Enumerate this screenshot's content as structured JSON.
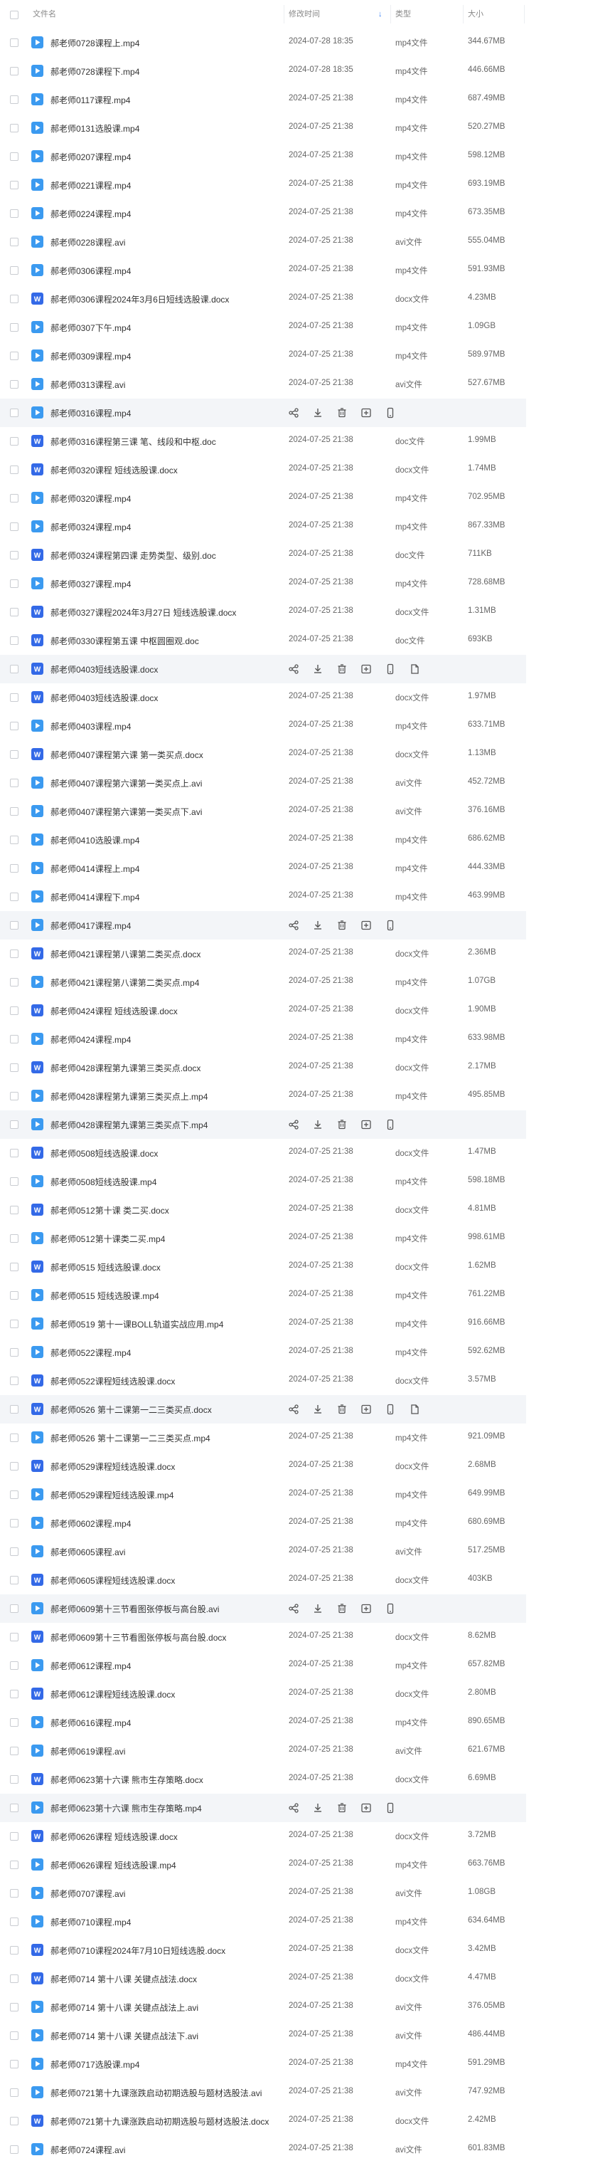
{
  "header": {
    "name": "文件名",
    "modified": "修改时间",
    "type": "类型",
    "size": "大小"
  },
  "rows": [
    {
      "name": "郝老师0728课程上.mp4",
      "date": "2024-07-28 18:35",
      "type": "mp4文件",
      "size": "344.67MB",
      "kind": "video"
    },
    {
      "name": "郝老师0728课程下.mp4",
      "date": "2024-07-28 18:35",
      "type": "mp4文件",
      "size": "446.66MB",
      "kind": "video"
    },
    {
      "name": "郝老师0117课程.mp4",
      "date": "2024-07-25 21:38",
      "type": "mp4文件",
      "size": "687.49MB",
      "kind": "video"
    },
    {
      "name": "郝老师0131选股课.mp4",
      "date": "2024-07-25 21:38",
      "type": "mp4文件",
      "size": "520.27MB",
      "kind": "video"
    },
    {
      "name": "郝老师0207课程.mp4",
      "date": "2024-07-25 21:38",
      "type": "mp4文件",
      "size": "598.12MB",
      "kind": "video"
    },
    {
      "name": "郝老师0221课程.mp4",
      "date": "2024-07-25 21:38",
      "type": "mp4文件",
      "size": "693.19MB",
      "kind": "video"
    },
    {
      "name": "郝老师0224课程.mp4",
      "date": "2024-07-25 21:38",
      "type": "mp4文件",
      "size": "673.35MB",
      "kind": "video"
    },
    {
      "name": "郝老师0228课程.avi",
      "date": "2024-07-25 21:38",
      "type": "avi文件",
      "size": "555.04MB",
      "kind": "video"
    },
    {
      "name": "郝老师0306课程.mp4",
      "date": "2024-07-25 21:38",
      "type": "mp4文件",
      "size": "591.93MB",
      "kind": "video"
    },
    {
      "name": "郝老师0306课程2024年3月6日短线选股课.docx",
      "date": "2024-07-25 21:38",
      "type": "docx文件",
      "size": "4.23MB",
      "kind": "doc"
    },
    {
      "name": "郝老师0307下午.mp4",
      "date": "2024-07-25 21:38",
      "type": "mp4文件",
      "size": "1.09GB",
      "kind": "video"
    },
    {
      "name": "郝老师0309课程.mp4",
      "date": "2024-07-25 21:38",
      "type": "mp4文件",
      "size": "589.97MB",
      "kind": "video"
    },
    {
      "name": "郝老师0313课程.avi",
      "date": "2024-07-25 21:38",
      "type": "avi文件",
      "size": "527.67MB",
      "kind": "video"
    },
    {
      "name": "郝老师0316课程.mp4",
      "hover": true,
      "kind": "video"
    },
    {
      "name": "郝老师0316课程第三课 笔、线段和中枢.doc",
      "date": "2024-07-25 21:38",
      "type": "doc文件",
      "size": "1.99MB",
      "kind": "doc"
    },
    {
      "name": "郝老师0320课程 短线选股课.docx",
      "date": "2024-07-25 21:38",
      "type": "docx文件",
      "size": "1.74MB",
      "kind": "doc"
    },
    {
      "name": "郝老师0320课程.mp4",
      "date": "2024-07-25 21:38",
      "type": "mp4文件",
      "size": "702.95MB",
      "kind": "video"
    },
    {
      "name": "郝老师0324课程.mp4",
      "date": "2024-07-25 21:38",
      "type": "mp4文件",
      "size": "867.33MB",
      "kind": "video"
    },
    {
      "name": "郝老师0324课程第四课 走势类型、级别.doc",
      "date": "2024-07-25 21:38",
      "type": "doc文件",
      "size": "711KB",
      "kind": "doc"
    },
    {
      "name": "郝老师0327课程.mp4",
      "date": "2024-07-25 21:38",
      "type": "mp4文件",
      "size": "728.68MB",
      "kind": "video"
    },
    {
      "name": "郝老师0327课程2024年3月27日 短线选股课.docx",
      "date": "2024-07-25 21:38",
      "type": "docx文件",
      "size": "1.31MB",
      "kind": "doc"
    },
    {
      "name": "郝老师0330课程第五课 中枢圆圈观.doc",
      "date": "2024-07-25 21:38",
      "type": "doc文件",
      "size": "693KB",
      "kind": "doc"
    },
    {
      "name": "郝老师0403短线选股课.docx",
      "hover": true,
      "kind": "doc",
      "extra": true
    },
    {
      "name": "郝老师0403短线选股课.docx",
      "date": "2024-07-25 21:38",
      "type": "docx文件",
      "size": "1.97MB",
      "kind": "doc"
    },
    {
      "name": "郝老师0403课程.mp4",
      "date": "2024-07-25 21:38",
      "type": "mp4文件",
      "size": "633.71MB",
      "kind": "video"
    },
    {
      "name": "郝老师0407课程第六课 第一类买点.docx",
      "date": "2024-07-25 21:38",
      "type": "docx文件",
      "size": "1.13MB",
      "kind": "doc"
    },
    {
      "name": "郝老师0407课程第六课第一类买点上.avi",
      "date": "2024-07-25 21:38",
      "type": "avi文件",
      "size": "452.72MB",
      "kind": "video"
    },
    {
      "name": "郝老师0407课程第六课第一类买点下.avi",
      "date": "2024-07-25 21:38",
      "type": "avi文件",
      "size": "376.16MB",
      "kind": "video"
    },
    {
      "name": "郝老师0410选股课.mp4",
      "date": "2024-07-25 21:38",
      "type": "mp4文件",
      "size": "686.62MB",
      "kind": "video"
    },
    {
      "name": "郝老师0414课程上.mp4",
      "date": "2024-07-25 21:38",
      "type": "mp4文件",
      "size": "444.33MB",
      "kind": "video"
    },
    {
      "name": "郝老师0414课程下.mp4",
      "date": "2024-07-25 21:38",
      "type": "mp4文件",
      "size": "463.99MB",
      "kind": "video"
    },
    {
      "name": "郝老师0417课程.mp4",
      "hover": true,
      "kind": "video"
    },
    {
      "name": "郝老师0421课程第八课第二类买点.docx",
      "date": "2024-07-25 21:38",
      "type": "docx文件",
      "size": "2.36MB",
      "kind": "doc"
    },
    {
      "name": "郝老师0421课程第八课第二类买点.mp4",
      "date": "2024-07-25 21:38",
      "type": "mp4文件",
      "size": "1.07GB",
      "kind": "video"
    },
    {
      "name": "郝老师0424课程 短线选股课.docx",
      "date": "2024-07-25 21:38",
      "type": "docx文件",
      "size": "1.90MB",
      "kind": "doc"
    },
    {
      "name": "郝老师0424课程.mp4",
      "date": "2024-07-25 21:38",
      "type": "mp4文件",
      "size": "633.98MB",
      "kind": "video"
    },
    {
      "name": "郝老师0428课程第九课第三类买点.docx",
      "date": "2024-07-25 21:38",
      "type": "docx文件",
      "size": "2.17MB",
      "kind": "doc"
    },
    {
      "name": "郝老师0428课程第九课第三类买点上.mp4",
      "date": "2024-07-25 21:38",
      "type": "mp4文件",
      "size": "495.85MB",
      "kind": "video"
    },
    {
      "name": "郝老师0428课程第九课第三类买点下.mp4",
      "hover": true,
      "kind": "video"
    },
    {
      "name": "郝老师0508短线选股课.docx",
      "date": "2024-07-25 21:38",
      "type": "docx文件",
      "size": "1.47MB",
      "kind": "doc"
    },
    {
      "name": "郝老师0508短线选股课.mp4",
      "date": "2024-07-25 21:38",
      "type": "mp4文件",
      "size": "598.18MB",
      "kind": "video"
    },
    {
      "name": "郝老师0512第十课 类二买.docx",
      "date": "2024-07-25 21:38",
      "type": "docx文件",
      "size": "4.81MB",
      "kind": "doc"
    },
    {
      "name": "郝老师0512第十课类二买.mp4",
      "date": "2024-07-25 21:38",
      "type": "mp4文件",
      "size": "998.61MB",
      "kind": "video"
    },
    {
      "name": "郝老师0515 短线选股课.docx",
      "date": "2024-07-25 21:38",
      "type": "docx文件",
      "size": "1.62MB",
      "kind": "doc"
    },
    {
      "name": "郝老师0515 短线选股课.mp4",
      "date": "2024-07-25 21:38",
      "type": "mp4文件",
      "size": "761.22MB",
      "kind": "video"
    },
    {
      "name": "郝老师0519 第十一课BOLL轨道实战应用.mp4",
      "date": "2024-07-25 21:38",
      "type": "mp4文件",
      "size": "916.66MB",
      "kind": "video"
    },
    {
      "name": "郝老师0522课程.mp4",
      "date": "2024-07-25 21:38",
      "type": "mp4文件",
      "size": "592.62MB",
      "kind": "video"
    },
    {
      "name": "郝老师0522课程短线选股课.docx",
      "date": "2024-07-25 21:38",
      "type": "docx文件",
      "size": "3.57MB",
      "kind": "doc"
    },
    {
      "name": "郝老师0526 第十二课第一二三类买点.docx",
      "hover": true,
      "kind": "doc",
      "extra": true
    },
    {
      "name": "郝老师0526 第十二课第一二三类买点.mp4",
      "date": "2024-07-25 21:38",
      "type": "mp4文件",
      "size": "921.09MB",
      "kind": "video"
    },
    {
      "name": "郝老师0529课程短线选股课.docx",
      "date": "2024-07-25 21:38",
      "type": "docx文件",
      "size": "2.68MB",
      "kind": "doc"
    },
    {
      "name": "郝老师0529课程短线选股课.mp4",
      "date": "2024-07-25 21:38",
      "type": "mp4文件",
      "size": "649.99MB",
      "kind": "video"
    },
    {
      "name": "郝老师0602课程.mp4",
      "date": "2024-07-25 21:38",
      "type": "mp4文件",
      "size": "680.69MB",
      "kind": "video"
    },
    {
      "name": "郝老师0605课程.avi",
      "date": "2024-07-25 21:38",
      "type": "avi文件",
      "size": "517.25MB",
      "kind": "video"
    },
    {
      "name": "郝老师0605课程短线选股课.docx",
      "date": "2024-07-25 21:38",
      "type": "docx文件",
      "size": "403KB",
      "kind": "doc"
    },
    {
      "name": "郝老师0609第十三节看图张停板与高台股.avi",
      "hover": true,
      "kind": "video"
    },
    {
      "name": "郝老师0609第十三节看图张停板与高台股.docx",
      "date": "2024-07-25 21:38",
      "type": "docx文件",
      "size": "8.62MB",
      "kind": "doc"
    },
    {
      "name": "郝老师0612课程.mp4",
      "date": "2024-07-25 21:38",
      "type": "mp4文件",
      "size": "657.82MB",
      "kind": "video"
    },
    {
      "name": "郝老师0612课程短线选股课.docx",
      "date": "2024-07-25 21:38",
      "type": "docx文件",
      "size": "2.80MB",
      "kind": "doc"
    },
    {
      "name": "郝老师0616课程.mp4",
      "date": "2024-07-25 21:38",
      "type": "mp4文件",
      "size": "890.65MB",
      "kind": "video"
    },
    {
      "name": "郝老师0619课程.avi",
      "date": "2024-07-25 21:38",
      "type": "avi文件",
      "size": "621.67MB",
      "kind": "video"
    },
    {
      "name": "郝老师0623第十六课 熊市生存策略.docx",
      "date": "2024-07-25 21:38",
      "type": "docx文件",
      "size": "6.69MB",
      "kind": "doc"
    },
    {
      "name": "郝老师0623第十六课 熊市生存策略.mp4",
      "hover": true,
      "kind": "video"
    },
    {
      "name": "郝老师0626课程 短线选股课.docx",
      "date": "2024-07-25 21:38",
      "type": "docx文件",
      "size": "3.72MB",
      "kind": "doc"
    },
    {
      "name": "郝老师0626课程 短线选股课.mp4",
      "date": "2024-07-25 21:38",
      "type": "mp4文件",
      "size": "663.76MB",
      "kind": "video"
    },
    {
      "name": "郝老师0707课程.avi",
      "date": "2024-07-25 21:38",
      "type": "avi文件",
      "size": "1.08GB",
      "kind": "video"
    },
    {
      "name": "郝老师0710课程.mp4",
      "date": "2024-07-25 21:38",
      "type": "mp4文件",
      "size": "634.64MB",
      "kind": "video"
    },
    {
      "name": "郝老师0710课程2024年7月10日短线选股.docx",
      "date": "2024-07-25 21:38",
      "type": "docx文件",
      "size": "3.42MB",
      "kind": "doc"
    },
    {
      "name": "郝老师0714 第十八课 关键点战法.docx",
      "date": "2024-07-25 21:38",
      "type": "docx文件",
      "size": "4.47MB",
      "kind": "doc"
    },
    {
      "name": "郝老师0714 第十八课 关键点战法上.avi",
      "date": "2024-07-25 21:38",
      "type": "avi文件",
      "size": "376.05MB",
      "kind": "video"
    },
    {
      "name": "郝老师0714 第十八课 关键点战法下.avi",
      "date": "2024-07-25 21:38",
      "type": "avi文件",
      "size": "486.44MB",
      "kind": "video"
    },
    {
      "name": "郝老师0717选股课.mp4",
      "date": "2024-07-25 21:38",
      "type": "mp4文件",
      "size": "591.29MB",
      "kind": "video"
    },
    {
      "name": "郝老师0721第十九课涨跌启动初期选股与题材选股法.avi",
      "date": "2024-07-25 21:38",
      "type": "avi文件",
      "size": "747.92MB",
      "kind": "video"
    },
    {
      "name": "郝老师0721第十九课涨跌启动初期选股与题材选股法.docx",
      "date": "2024-07-25 21:38",
      "type": "docx文件",
      "size": "2.42MB",
      "kind": "doc"
    },
    {
      "name": "郝老师0724课程.avi",
      "date": "2024-07-25 21:38",
      "type": "avi文件",
      "size": "601.83MB",
      "kind": "video"
    }
  ],
  "icons": {
    "video": "play-file-icon",
    "doc": "word-doc-icon",
    "actions": [
      "share-icon",
      "download-icon",
      "delete-icon",
      "rename-icon",
      "mobile-icon",
      "copy-icon"
    ]
  },
  "colors": {
    "video_icon": "#3b9af0",
    "doc_icon": "#3369e7",
    "hover_row": "#f3f5f8",
    "sort_accent": "#3b82f6"
  }
}
